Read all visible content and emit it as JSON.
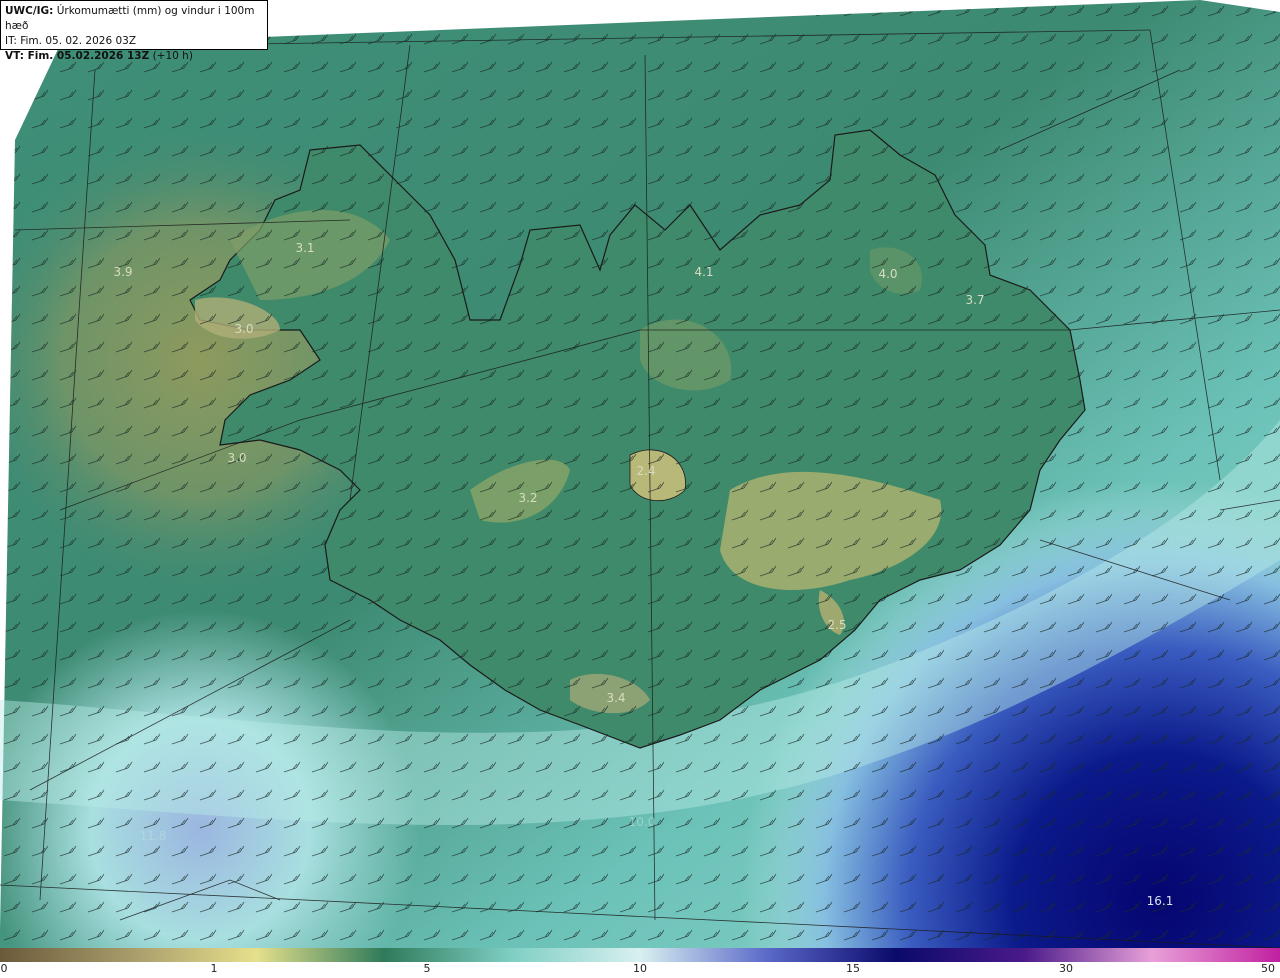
{
  "header": {
    "product": "UWC/IG:",
    "description": "Úrkomumætti (mm) og vindur i 100m hæð",
    "issue_time": "IT: Fim. 05. 02. 2026 03Z",
    "valid_label": "VT: Fim. 05.02.2026 13Z",
    "valid_offset": "(+10 h)"
  },
  "map_labels": [
    {
      "text": "3.9"
    },
    {
      "text": "3.1"
    },
    {
      "text": "3.0"
    },
    {
      "text": "3.0"
    },
    {
      "text": "3.2"
    },
    {
      "text": "2.4"
    },
    {
      "text": "4.1"
    },
    {
      "text": "4.0"
    },
    {
      "text": "3.7"
    },
    {
      "text": "2.5"
    },
    {
      "text": "3.4"
    },
    {
      "text": "10.0"
    },
    {
      "text": "16.1"
    },
    {
      "text": "11.8"
    }
  ],
  "colorbar": {
    "ticks": [
      "0",
      "1",
      "5",
      "10",
      "15",
      "30",
      "50"
    ],
    "colors": [
      "#6b5a3a",
      "#a69a6a",
      "#e6e08c",
      "#2f7a5a",
      "#7fcfc4",
      "#d8f0f0",
      "#5a68c8",
      "#0a0a6a",
      "#4a1a8a",
      "#e8a0d8",
      "#c020a0"
    ]
  }
}
